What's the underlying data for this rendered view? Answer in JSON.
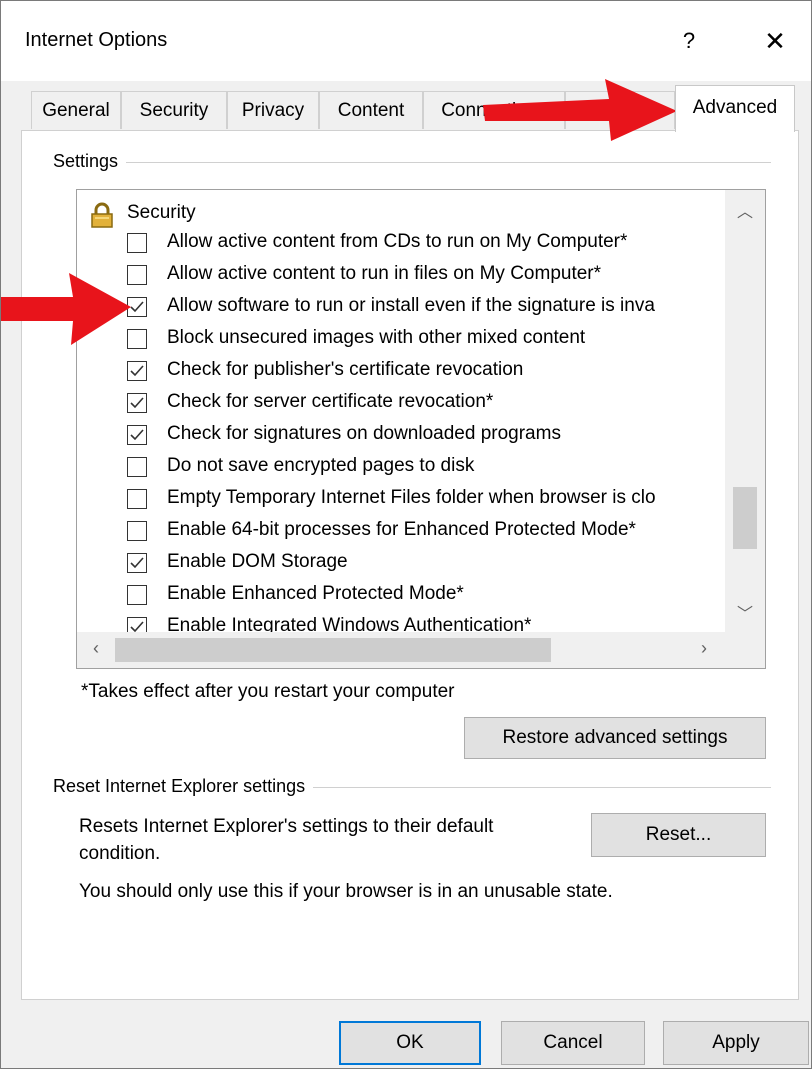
{
  "window": {
    "title": "Internet Options",
    "help_label": "?",
    "close_label": "✕"
  },
  "tabs": [
    {
      "label": "General"
    },
    {
      "label": "Security"
    },
    {
      "label": "Privacy"
    },
    {
      "label": "Content"
    },
    {
      "label": "Connections"
    },
    {
      "label": "Programs"
    },
    {
      "label": "Advanced",
      "active": true
    }
  ],
  "settings": {
    "group_label": "Settings",
    "category": {
      "label": "Security",
      "icon": "lock-icon"
    },
    "options": [
      {
        "label": "Allow active content from CDs to run on My Computer*",
        "checked": false
      },
      {
        "label": "Allow active content to run in files on My Computer*",
        "checked": false
      },
      {
        "label": "Allow software to run or install even if the signature is inva",
        "checked": true
      },
      {
        "label": "Block unsecured images with other mixed content",
        "checked": false
      },
      {
        "label": "Check for publisher's certificate revocation",
        "checked": true
      },
      {
        "label": "Check for server certificate revocation*",
        "checked": true
      },
      {
        "label": "Check for signatures on downloaded programs",
        "checked": true
      },
      {
        "label": "Do not save encrypted pages to disk",
        "checked": false
      },
      {
        "label": "Empty Temporary Internet Files folder when browser is clo",
        "checked": false
      },
      {
        "label": "Enable 64-bit processes for Enhanced Protected Mode*",
        "checked": false
      },
      {
        "label": "Enable DOM Storage",
        "checked": true
      },
      {
        "label": "Enable Enhanced Protected Mode*",
        "checked": false
      },
      {
        "label": "Enable Integrated Windows Authentication*",
        "checked": true
      }
    ],
    "footnote": "*Takes effect after you restart your computer",
    "restore_label": "Restore advanced settings"
  },
  "reset": {
    "group_label": "Reset Internet Explorer settings",
    "description_line1": "Resets Internet Explorer's settings to their default",
    "description_line2": "condition.",
    "button_label": "Reset...",
    "warning": "You should only use this if your browser is in an unusable state."
  },
  "buttons": {
    "ok": "OK",
    "cancel": "Cancel",
    "apply": "Apply"
  },
  "annotations": {
    "arrow_color": "#e8141b"
  },
  "colors": {
    "focus_border": "#0078d7",
    "lock": "#d8a328"
  }
}
